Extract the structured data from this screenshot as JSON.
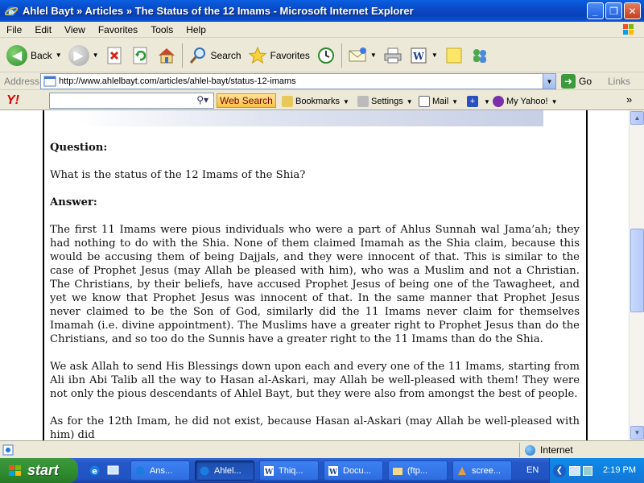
{
  "window": {
    "title": "Ahlel Bayt » Articles » The Status of the 12 Imams - Microsoft Internet Explorer",
    "min_glyph": "_",
    "max_glyph": "❐",
    "close_glyph": "✕"
  },
  "menu": [
    "File",
    "Edit",
    "View",
    "Favorites",
    "Tools",
    "Help"
  ],
  "toolbar": {
    "back": "Back",
    "search": "Search",
    "favorites": "Favorites"
  },
  "address": {
    "label": "Address",
    "url": "http://www.ahlelbayt.com/articles/ahlel-bayt/status-12-imams",
    "go": "Go",
    "links": "Links"
  },
  "yahoo": {
    "logo": "Y!",
    "web_search": "Web Search",
    "bookmarks": "Bookmarks",
    "settings": "Settings",
    "mail": "Mail",
    "my_yahoo": "My Yahoo!"
  },
  "article": {
    "question_heading": "Question:",
    "question": "What is the status of the 12 Imams of the Shia?",
    "answer_heading": "Answer:",
    "paragraphs": [
      "The first 11 Imams were pious individuals who were a part of Ahlus Sunnah wal Jama’ah; they had nothing to do with the Shia. None of them claimed Imamah as the Shia claim, because this would be accusing them of being Dajjals, and they were innocent of that. This is similar to the case of Prophet Jesus (may Allah be pleased with him), who was a Muslim and not a Christian. The Christians, by their beliefs, have accused Prophet Jesus of being one of the Tawagheet, and yet we know that Prophet Jesus was innocent of that. In the same manner that Prophet Jesus never claimed to be the Son of God, similarly did the 11 Imams never claim for themselves Imamah (i.e. divine appointment). The Muslims have a greater right to Prophet Jesus than do the Christians, and so too do the Sunnis have a greater right to the 11 Imams than do the Shia.",
      "We ask Allah to send His Blessings down upon each and every one of the 11 Imams, starting from Ali ibn Abi Talib all the way to Hasan al-Askari, may Allah be well-pleased with them! They were not only the pious descendants of Ahlel Bayt, but they were also from amongst the best of people.",
      "As for the 12th Imam, he did not exist, because Hasan al-Askari (may Allah be well-pleased with him) did"
    ]
  },
  "status": {
    "zone": "Internet"
  },
  "taskbar": {
    "start": "start",
    "tasks": [
      "Ans...",
      "Ahlel...",
      "Thiq...",
      "Docu...",
      "(ftp...",
      "scree..."
    ],
    "lang": "EN",
    "clock": "2:19 PM"
  }
}
